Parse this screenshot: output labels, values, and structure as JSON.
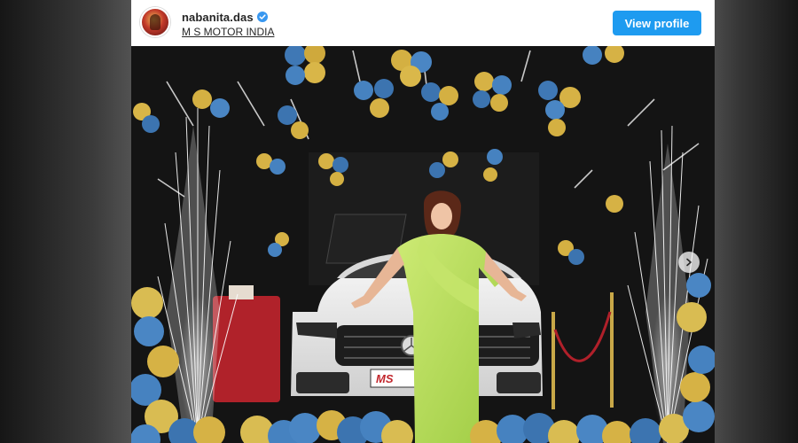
{
  "post": {
    "username": "nabanita.das",
    "verified": true,
    "location": "M S MOTOR INDIA",
    "view_profile_label": "View profile"
  },
  "photo": {
    "plate_text": "MS"
  },
  "colors": {
    "button": "#1e9bf0",
    "verified_badge": "#3897f0",
    "saree": "#b7e05a"
  },
  "icons": {
    "verified": "verified-badge-icon",
    "carousel_next": "chevron-right-icon"
  }
}
